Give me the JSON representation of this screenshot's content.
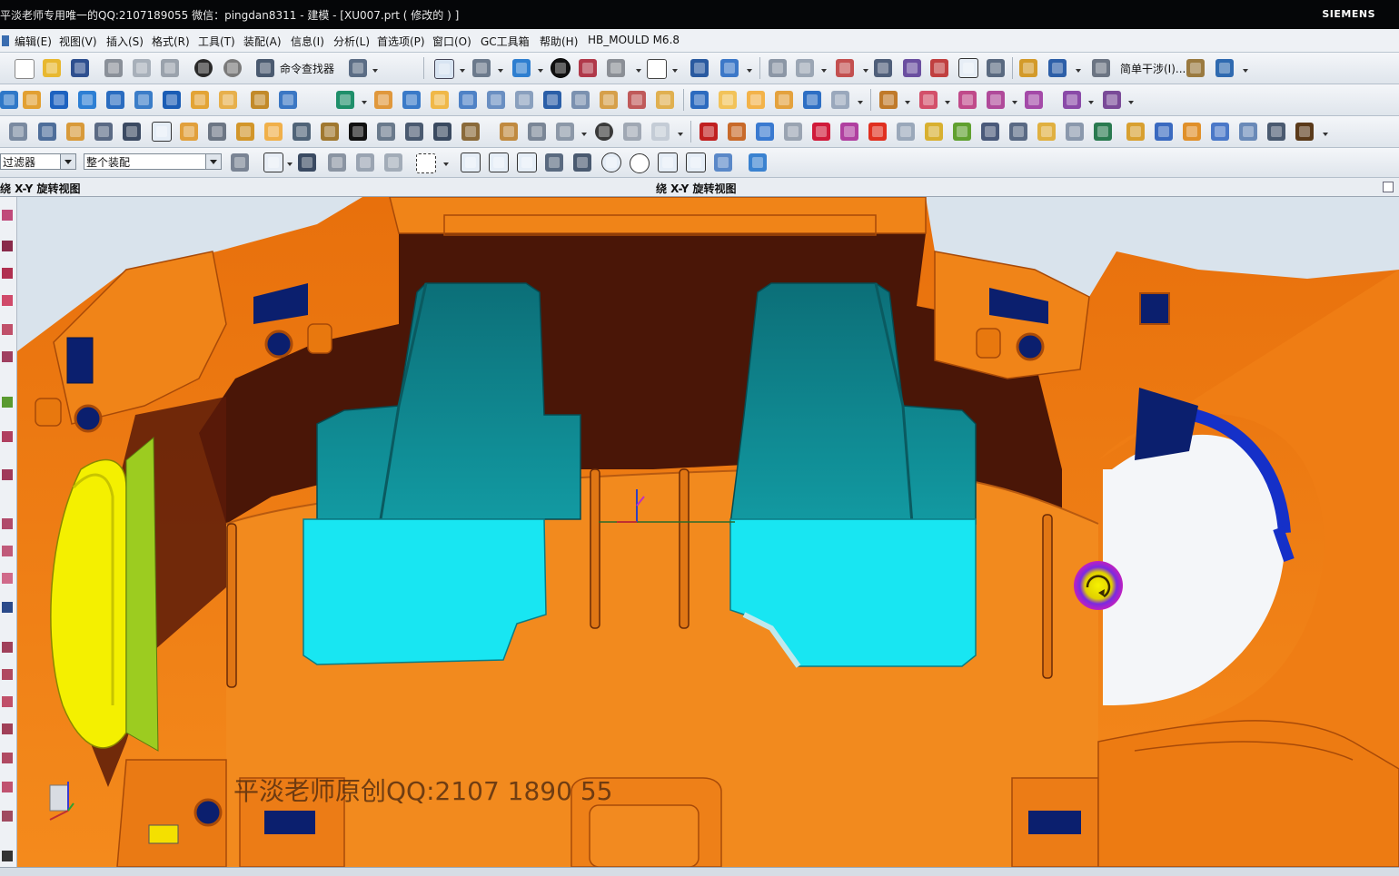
{
  "window": {
    "title": "平淡老师专用唯一的QQ:2107189055  微信：pingdan8311 - 建模 - [XU007.prt  ( 修改的 ) ]",
    "brand": "SIEMENS"
  },
  "menu": {
    "items": [
      "编辑(E)",
      "视图(V)",
      "插入(S)",
      "格式(R)",
      "工具(T)",
      "装配(A)",
      "信息(I)",
      "分析(L)",
      "首选项(P)",
      "窗口(O)",
      "GC工具箱",
      "帮助(H)",
      "HB_MOULD M6.8"
    ]
  },
  "toolbar": {
    "command_finder": "命令查找器",
    "simple_interference": "简单干涉(I)..."
  },
  "selection_bar": {
    "filter_value": "过滤器",
    "scope_value": "整个装配"
  },
  "view_header": {
    "left_title": "绕 X-Y 旋转视图",
    "center_title": "绕 X-Y 旋转视图"
  },
  "viewport": {
    "watermark": "平淡老师原创QQ:2107 1890 55",
    "colors": {
      "orange": "#f07c12",
      "dark_brown": "#4a1607",
      "teal": "#0f8a8e",
      "cyan": "#18e6f2",
      "yellow": "#f4f000",
      "navy": "#0b1f6e",
      "background": "#d9e3ec"
    }
  },
  "icons": {
    "rotate_cursor": "rotate-cursor-icon",
    "coordinate_triad": "wcs-triad-icon"
  }
}
